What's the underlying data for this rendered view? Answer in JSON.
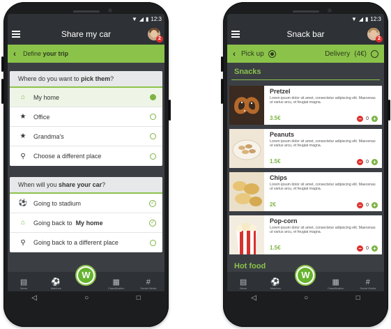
{
  "status_time": "12:3",
  "nav": {
    "items": [
      {
        "label": "News",
        "icon": "newspaper-icon",
        "glyph": "▤"
      },
      {
        "label": "Matches",
        "icon": "soccer-ball-icon",
        "glyph": "⚽"
      },
      {
        "label": "Classification",
        "icon": "table-icon",
        "glyph": "▦"
      },
      {
        "label": "Social Media",
        "icon": "hashtag-icon",
        "glyph": "#"
      }
    ],
    "logo_letter": "W"
  },
  "sysnav": {
    "back": "◁",
    "home": "○",
    "recents": "□"
  },
  "left": {
    "title": "Share my car",
    "badge": "2",
    "subbar": {
      "prefix": "Define ",
      "bold": "your trip"
    },
    "card1": {
      "head_prefix": "Where do you want to ",
      "head_bold": "pick them",
      "head_suffix": "?",
      "options": [
        {
          "label": "My home",
          "icon": "home-icon",
          "glyph": "⌂",
          "selected": true
        },
        {
          "label": "Office",
          "icon": "star-icon",
          "glyph": "★",
          "selected": false
        },
        {
          "label": "Grandma's",
          "icon": "star-icon",
          "glyph": "★",
          "selected": false
        },
        {
          "label": "Choose a different place",
          "icon": "location-pin-icon",
          "glyph": "⚲",
          "selected": false
        }
      ]
    },
    "card2": {
      "head_prefix": "When will you ",
      "head_bold": "share your car",
      "head_suffix": "?",
      "options": [
        {
          "label": "Going to stadium",
          "label_bold": "",
          "icon": "soccer-ball-icon",
          "glyph": "⚽"
        },
        {
          "label": "Going back to ",
          "label_bold": "My home",
          "icon": "home-icon",
          "glyph": "⌂"
        },
        {
          "label": "Going back to a different place",
          "label_bold": "",
          "icon": "location-pin-icon",
          "glyph": "⚲"
        }
      ]
    }
  },
  "right": {
    "title": "Snack bar",
    "badge": "2",
    "pickup_label": "Pick up",
    "delivery_label": "Delivery",
    "delivery_price": "(4€)",
    "section1": "Snacks",
    "section2": "Hot food",
    "items": [
      {
        "name": "Pretzel",
        "desc": "Lorem ipsum dolor sit amet, consectetur adipiscing elit. Maecenas ut varius arcu, et feugiat magna.",
        "price": "3.5€",
        "qty": "0"
      },
      {
        "name": "Peanuts",
        "desc": "Lorem ipsum dolor sit amet, consectetur adipiscing elit. Maecenas ut varius arcu, et feugiat magna.",
        "price": "1.5€",
        "qty": "0"
      },
      {
        "name": "Chips",
        "desc": "Lorem ipsum dolor sit amet, consectetur adipiscing elit. Maecenas ut varius arcu, et feugiat magna.",
        "price": "2€",
        "qty": "0"
      },
      {
        "name": "Pop-corn",
        "desc": "Lorem ipsum dolor sit amet, consectetur adipiscing elit. Maecenas ut varius arcu, et feugiat magna.",
        "price": "1.5€",
        "qty": "0"
      }
    ]
  },
  "colors": {
    "accent": "#8bc34a",
    "dark": "#2e3135",
    "minus": "#e0312f"
  }
}
